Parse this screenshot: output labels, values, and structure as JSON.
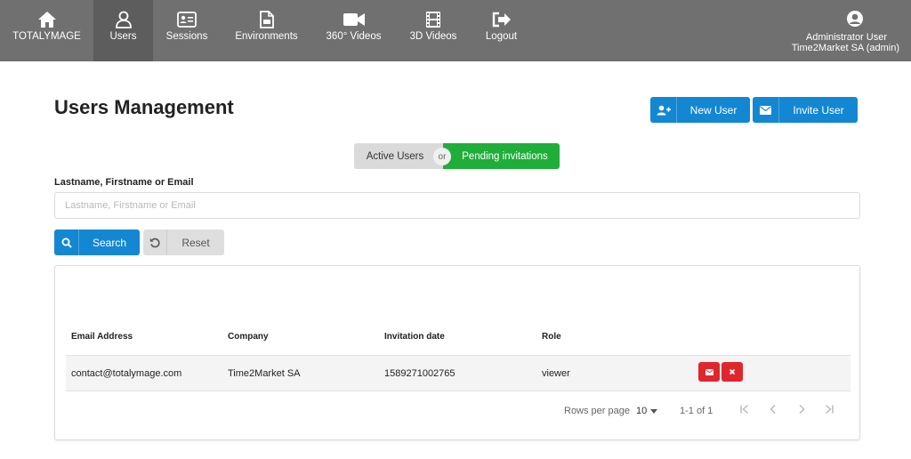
{
  "nav": {
    "items": [
      {
        "label": "TOTALYMAGE",
        "icon": "home-icon"
      },
      {
        "label": "Users",
        "icon": "user-icon",
        "active": true
      },
      {
        "label": "Sessions",
        "icon": "id-card-icon"
      },
      {
        "label": "Environments",
        "icon": "file-icon"
      },
      {
        "label": "360° Videos",
        "icon": "video-camera-icon"
      },
      {
        "label": "3D Videos",
        "icon": "film-icon"
      },
      {
        "label": "Logout",
        "icon": "sign-out-icon"
      }
    ],
    "user": {
      "name": "Administrator User",
      "org": "Time2Market SA (admin)",
      "icon": "user-circle-icon"
    }
  },
  "page": {
    "title": "Users Management",
    "new_user_label": "New User",
    "invite_user_label": "Invite User"
  },
  "toggle": {
    "active_label": "Active Users",
    "or_label": "or",
    "pending_label": "Pending invitations",
    "selected": "pending"
  },
  "search": {
    "label": "Lastname, Firstname or Email",
    "placeholder": "Lastname, Firstname or Email",
    "value": "",
    "search_label": "Search",
    "reset_label": "Reset"
  },
  "table": {
    "headers": {
      "email": "Email Address",
      "company": "Company",
      "date": "Invitation date",
      "role": "Role"
    },
    "rows": [
      {
        "email": "contact@totalymage.com",
        "company": "Time2Market SA",
        "date": "1589271002765",
        "role": "viewer"
      }
    ],
    "pagination": {
      "rows_per_page_label": "Rows per page",
      "rows_per_page": "10",
      "range": "1-1 of 1"
    }
  },
  "colors": {
    "nav_bg": "#707070",
    "primary": "#1487d3",
    "success": "#1fae3a",
    "danger": "#e0262d"
  }
}
